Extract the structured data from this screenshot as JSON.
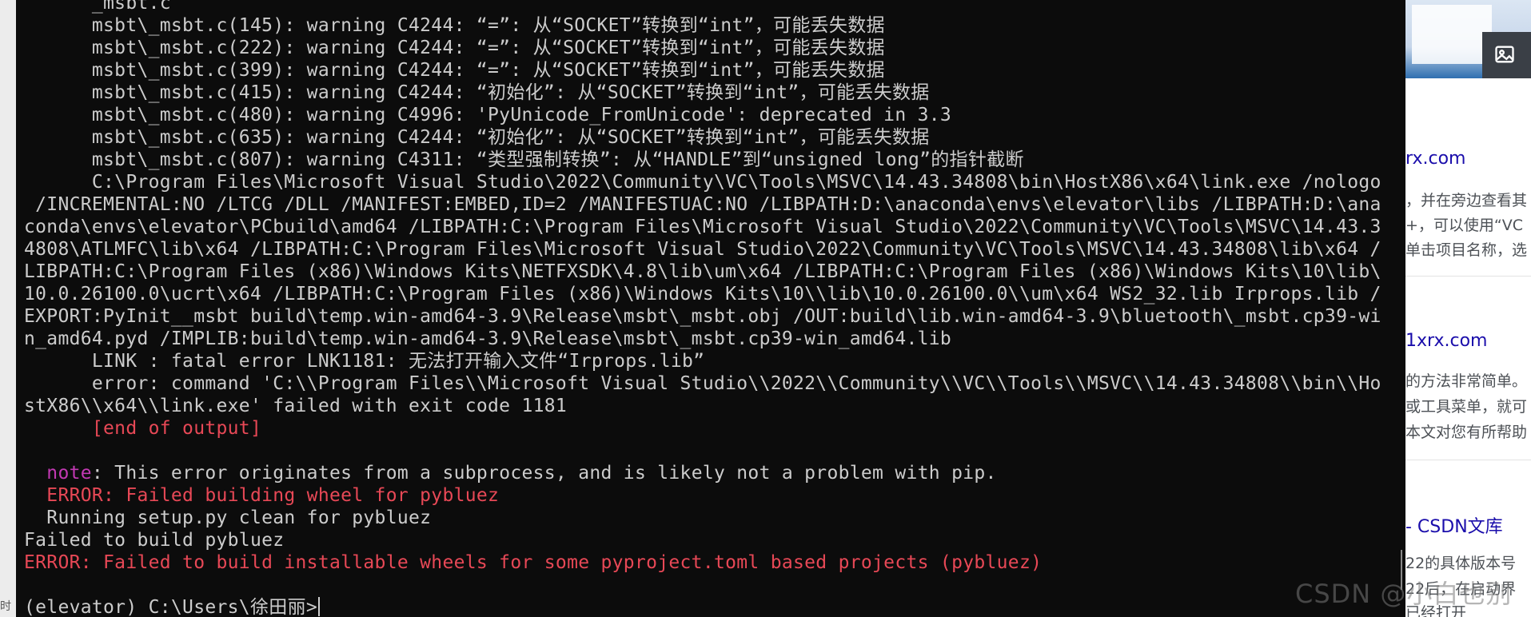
{
  "left_strip": {
    "text": "时"
  },
  "terminal": {
    "lines": [
      {
        "text": "      _msbt.c",
        "color": "default"
      },
      {
        "text": "      msbt\\_msbt.c(145): warning C4244: “=”: 从“SOCKET”转换到“int”，可能丢失数据",
        "color": "default"
      },
      {
        "text": "      msbt\\_msbt.c(222): warning C4244: “=”: 从“SOCKET”转换到“int”，可能丢失数据",
        "color": "default"
      },
      {
        "text": "      msbt\\_msbt.c(399): warning C4244: “=”: 从“SOCKET”转换到“int”，可能丢失数据",
        "color": "default"
      },
      {
        "text": "      msbt\\_msbt.c(415): warning C4244: “初始化”: 从“SOCKET”转换到“int”，可能丢失数据",
        "color": "default"
      },
      {
        "text": "      msbt\\_msbt.c(480): warning C4996: 'PyUnicode_FromUnicode': deprecated in 3.3",
        "color": "default"
      },
      {
        "text": "      msbt\\_msbt.c(635): warning C4244: “初始化”: 从“SOCKET”转换到“int”，可能丢失数据",
        "color": "default"
      },
      {
        "text": "      msbt\\_msbt.c(807): warning C4311: “类型强制转换”: 从“HANDLE”到“unsigned long”的指针截断",
        "color": "default"
      },
      {
        "text": "      C:\\Program Files\\Microsoft Visual Studio\\2022\\Community\\VC\\Tools\\MSVC\\14.43.34808\\bin\\HostX86\\x64\\link.exe /nologo",
        "color": "default"
      },
      {
        "text": " /INCREMENTAL:NO /LTCG /DLL /MANIFEST:EMBED,ID=2 /MANIFESTUAC:NO /LIBPATH:D:\\anaconda\\envs\\elevator\\libs /LIBPATH:D:\\ana",
        "color": "default"
      },
      {
        "text": "conda\\envs\\elevator\\PCbuild\\amd64 /LIBPATH:C:\\Program Files\\Microsoft Visual Studio\\2022\\Community\\VC\\Tools\\MSVC\\14.43.3",
        "color": "default"
      },
      {
        "text": "4808\\ATLMFC\\lib\\x64 /LIBPATH:C:\\Program Files\\Microsoft Visual Studio\\2022\\Community\\VC\\Tools\\MSVC\\14.43.34808\\lib\\x64 /",
        "color": "default"
      },
      {
        "text": "LIBPATH:C:\\Program Files (x86)\\Windows Kits\\NETFXSDK\\4.8\\lib\\um\\x64 /LIBPATH:C:\\Program Files (x86)\\Windows Kits\\10\\lib\\",
        "color": "default"
      },
      {
        "text": "10.0.26100.0\\ucrt\\x64 /LIBPATH:C:\\Program Files (x86)\\Windows Kits\\10\\\\lib\\10.0.26100.0\\\\um\\x64 WS2_32.lib Irprops.lib /",
        "color": "default"
      },
      {
        "text": "EXPORT:PyInit__msbt build\\temp.win-amd64-3.9\\Release\\msbt\\_msbt.obj /OUT:build\\lib.win-amd64-3.9\\bluetooth\\_msbt.cp39-wi",
        "color": "default"
      },
      {
        "text": "n_amd64.pyd /IMPLIB:build\\temp.win-amd64-3.9\\Release\\msbt\\_msbt.cp39-win_amd64.lib",
        "color": "default"
      },
      {
        "text": "      LINK : fatal error LNK1181: 无法打开输入文件“Irprops.lib”",
        "color": "default"
      },
      {
        "text": "      error: command 'C:\\\\Program Files\\\\Microsoft Visual Studio\\\\2022\\\\Community\\\\VC\\\\Tools\\\\MSVC\\\\14.43.34808\\\\bin\\\\Ho",
        "color": "default"
      },
      {
        "text": "stX86\\\\x64\\\\link.exe' failed with exit code 1181",
        "color": "default"
      },
      {
        "text": "      [end of output]",
        "color": "red"
      },
      {
        "text": "",
        "color": "default"
      },
      {
        "prefix": "  ",
        "highlight": "note",
        "rest": ": This error originates from a subprocess, and is likely not a problem with pip.",
        "color": "note"
      },
      {
        "text": "  ERROR: Failed building wheel for pybluez",
        "color": "red"
      },
      {
        "text": "  Running setup.py clean for pybluez",
        "color": "default"
      },
      {
        "text": "Failed to build pybluez",
        "color": "default"
      },
      {
        "text": "ERROR: Failed to build installable wheels for some pyproject.toml based projects (pybluez)",
        "color": "red"
      },
      {
        "text": "",
        "color": "default"
      },
      {
        "text": "(elevator) C:\\Users\\徐田丽>",
        "color": "prompt"
      }
    ],
    "colors": {
      "default": "#cccccc",
      "red": "#e74856",
      "magenta": "#c239b3",
      "background": "#0c0c0c"
    }
  },
  "browser": {
    "image_icon": "image-icon",
    "results": [
      {
        "link": "rx.com",
        "snippet_lines": [
          "，并在旁边查看其",
          "+，可以使用“VC",
          "单击项目名称，选"
        ]
      },
      {
        "link": "1xrx.com",
        "snippet_lines": [
          "的方法非常简单。",
          "或工具菜单，就可",
          "本文对您有所帮助"
        ]
      },
      {
        "link": "- CSDN文库",
        "snippet_lines": [
          "22的具体版本号",
          "22后，在启动界",
          "已经打开"
        ]
      }
    ]
  },
  "watermark": "CSDN @小白也别"
}
